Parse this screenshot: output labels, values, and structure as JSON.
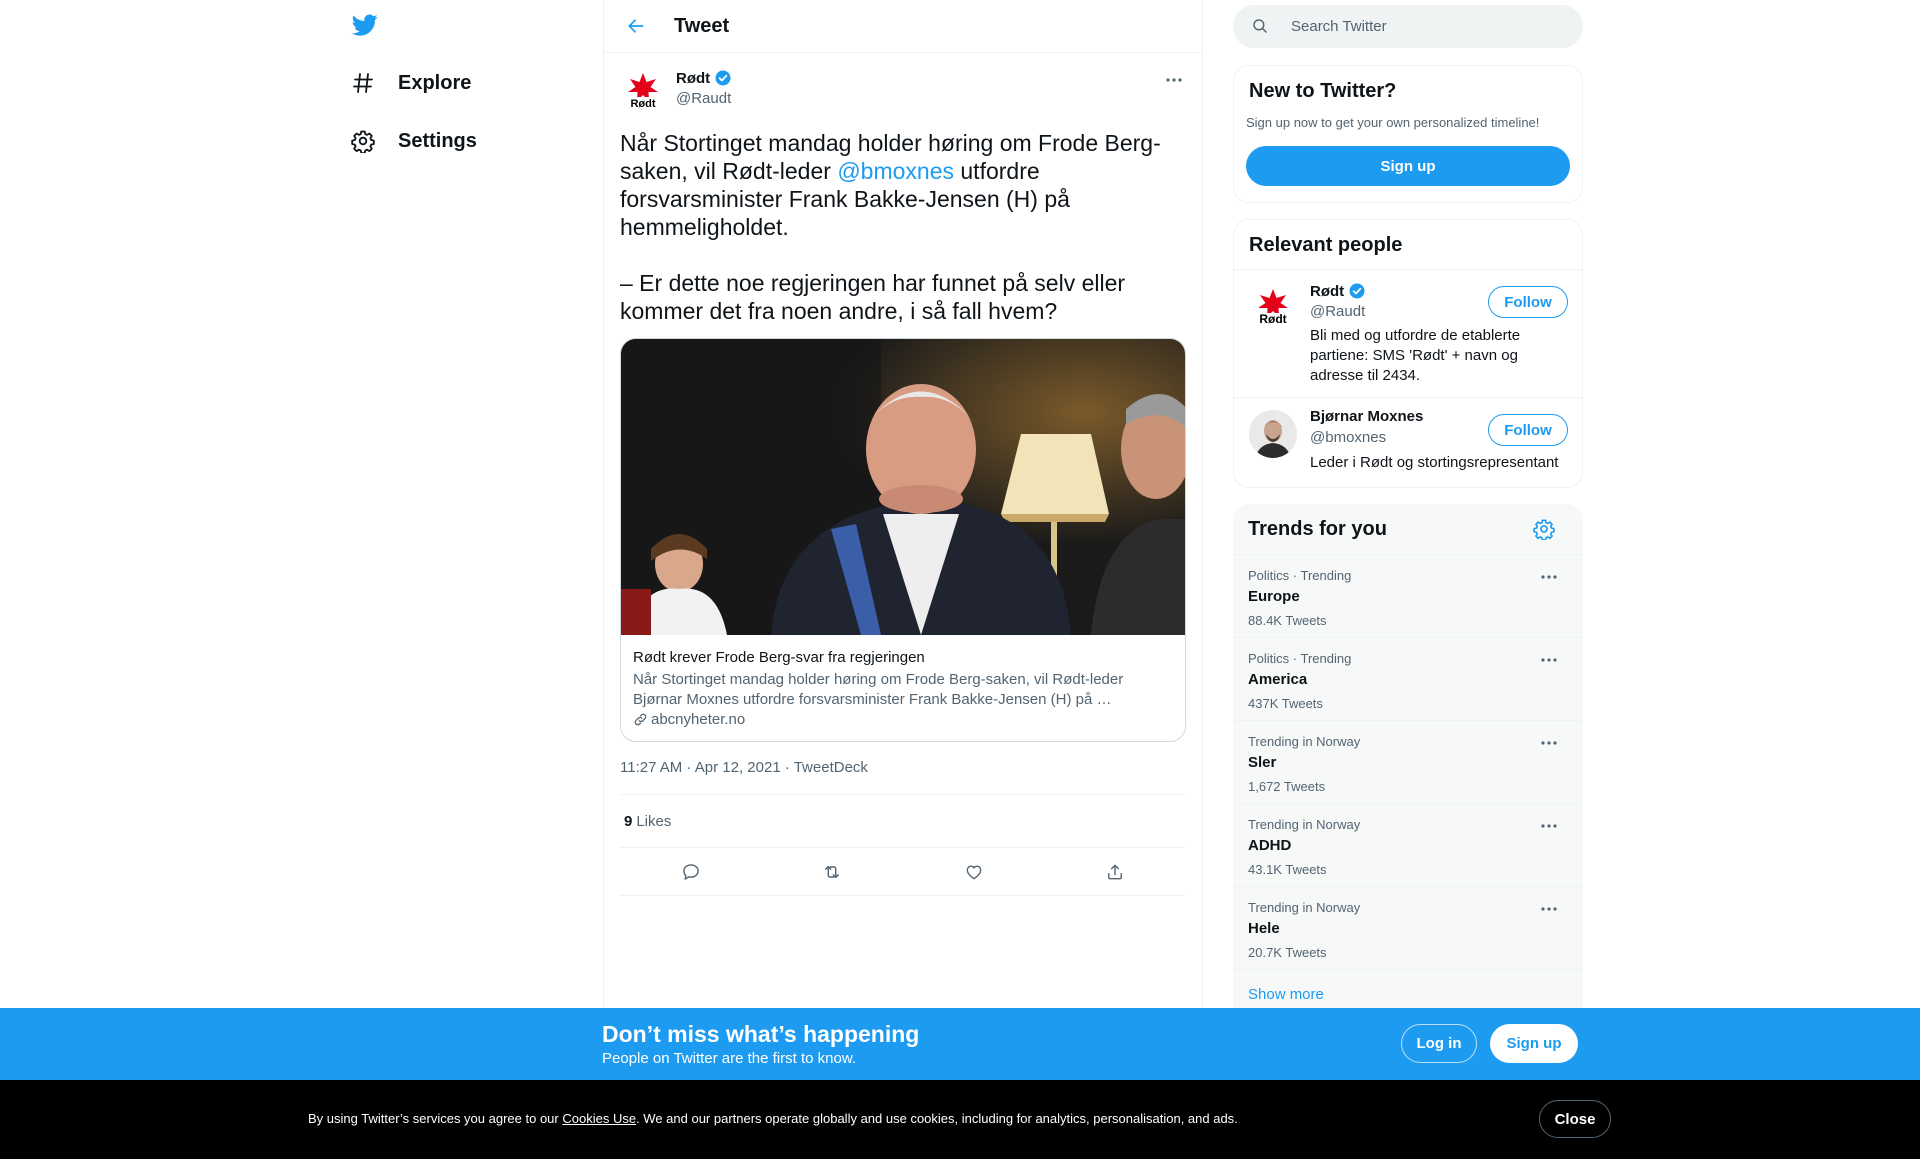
{
  "nav": {
    "explore_label": "Explore",
    "settings_label": "Settings"
  },
  "header": {
    "title": "Tweet"
  },
  "tweet": {
    "author_name": "Rødt",
    "author_handle": "@Raudt",
    "text_part1": "Når Stortinget mandag holder høring om Frode Berg-saken, vil Rødt-leder ",
    "mention": "@bmoxnes",
    "text_part2": " utfordre forsvarsminister Frank Bakke-Jensen (H) på hemmeligholdet.\n\n– Er dette noe regjeringen har funnet på selv eller kommer det fra noen andre, i så fall hvem?",
    "card_title": "Rødt krever Frode Berg-svar fra regjeringen",
    "card_desc": "Når Stortinget mandag holder høring om Frode Berg-saken, vil Rødt-leder Bjørnar Moxnes utfordre forsvarsminister Frank Bakke-Jensen (H) på …",
    "card_domain": "abcnyheter.no",
    "timestamp": "11:27 AM · Apr 12, 2021 · TweetDeck",
    "likes_count": "9",
    "likes_label": "Likes"
  },
  "search": {
    "placeholder": "Search Twitter"
  },
  "new_to_twitter": {
    "title": "New to Twitter?",
    "subtitle": "Sign up now to get your own personalized timeline!",
    "signup_label": "Sign up"
  },
  "relevant_people": {
    "title": "Relevant people",
    "people": [
      {
        "name": "Rødt",
        "handle": "@Raudt",
        "bio": "Bli med og utfordre de etablerte partiene: SMS 'Rødt' + navn og adresse til 2434.",
        "follow_label": "Follow"
      },
      {
        "name": "Bjørnar Moxnes",
        "handle": "@bmoxnes",
        "bio": "Leder i Rødt og stortingsrepresentant",
        "follow_label": "Follow"
      }
    ]
  },
  "trends": {
    "title": "Trends for you",
    "items": [
      {
        "meta": "Politics · Trending",
        "name": "Europe",
        "count": "88.4K Tweets"
      },
      {
        "meta": "Politics · Trending",
        "name": "America",
        "count": "437K Tweets"
      },
      {
        "meta": "Trending in Norway",
        "name": "Sler",
        "count": "1,672 Tweets"
      },
      {
        "meta": "Trending in Norway",
        "name": "ADHD",
        "count": "43.1K Tweets"
      },
      {
        "meta": "Trending in Norway",
        "name": "Hele",
        "count": "20.7K Tweets"
      }
    ],
    "show_more": "Show more"
  },
  "bottom_bar": {
    "title": "Don’t miss what’s happening",
    "subtitle": "People on Twitter are the first to know.",
    "login_label": "Log in",
    "signup_label": "Sign up"
  },
  "cookie": {
    "text_before": "By using Twitter’s services you agree to our ",
    "link": "Cookies Use",
    "text_after": ". We and our partners operate globally and use cookies, including for analytics, personalisation, and ads.",
    "close_label": "Close"
  },
  "colors": {
    "brand_blue": "#1d9bf0",
    "text_primary": "#0f1419",
    "text_secondary": "#536471",
    "rodt_red": "#e5001a"
  }
}
